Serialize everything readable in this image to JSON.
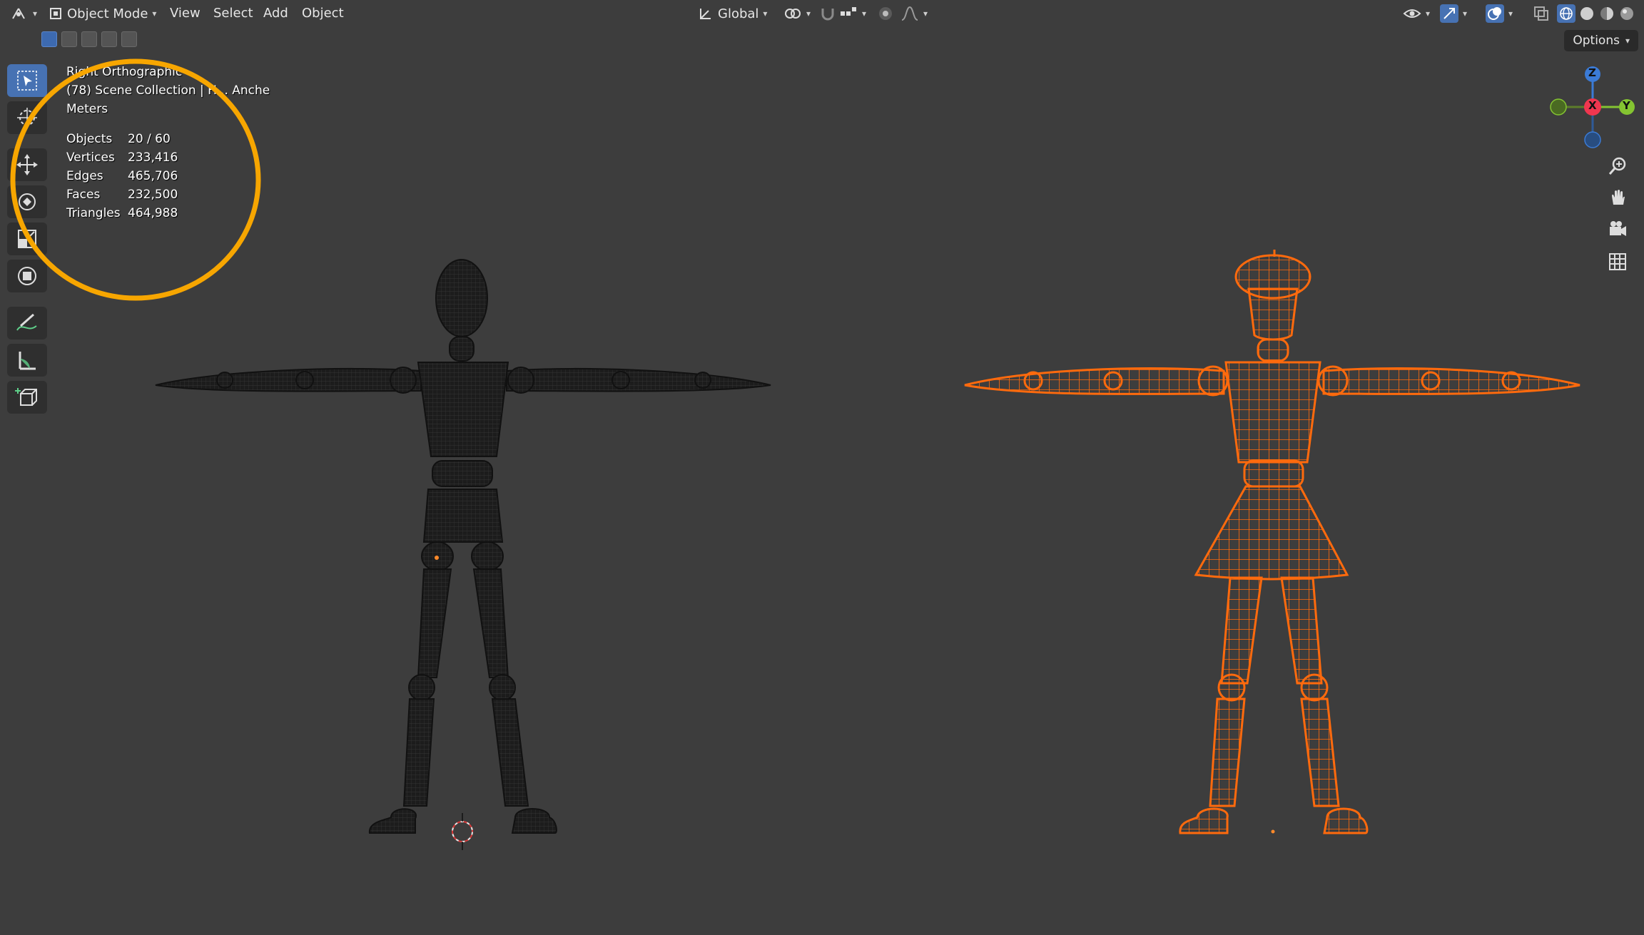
{
  "header": {
    "editor_type_icon": "viewport-icon",
    "mode_label": "Object Mode",
    "menus": [
      "View",
      "Select",
      "Add",
      "Object"
    ],
    "transform_orientation": "Global",
    "options_label": "Options"
  },
  "overlay": {
    "view_name": "Right Orthographic",
    "collection_line": "(78) Scene Collection | H... Anche",
    "units": "Meters",
    "stats": [
      {
        "label": "Objects",
        "value": "20 / 60"
      },
      {
        "label": "Vertices",
        "value": "233,416"
      },
      {
        "label": "Edges",
        "value": "465,706"
      },
      {
        "label": "Faces",
        "value": "232,500"
      },
      {
        "label": "Triangles",
        "value": "464,988"
      }
    ]
  },
  "gizmo": {
    "z": "Z",
    "x": "X",
    "y": "Y"
  },
  "colors": {
    "highlight_ring": "#f7a600",
    "selected": "#ff6a0d",
    "mannequin": "#1c1c1c",
    "active_tool": "#4772b3"
  },
  "tools": [
    "select-box-icon",
    "cursor-icon",
    "move-icon",
    "rotate-icon",
    "scale-icon",
    "transform-icon",
    "annotate-icon",
    "measure-icon",
    "add-cube-icon"
  ]
}
